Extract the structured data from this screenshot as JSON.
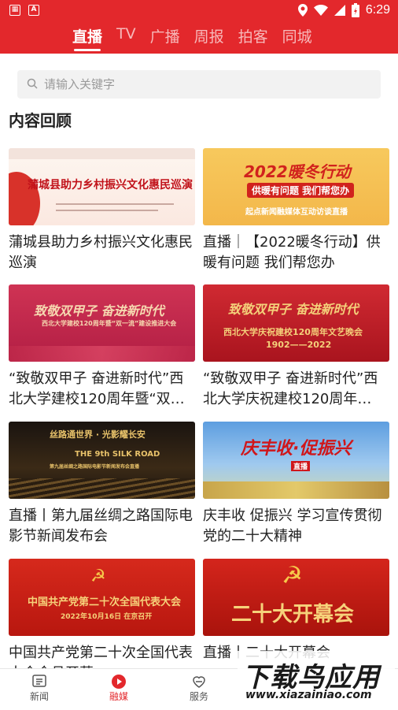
{
  "status": {
    "time": "6:29"
  },
  "tabs": [
    "直播",
    "TV",
    "广播",
    "周报",
    "拍客",
    "同城"
  ],
  "search": {
    "placeholder": "请输入关键字"
  },
  "section_title": "内容回顾",
  "cards": [
    {
      "caption": "蒲城县助力乡村振兴文化惠民巡演",
      "thumb_text": "蒲城县助力乡村振兴文化惠民巡演",
      "thumb_top": "",
      "thumb_bottom": ""
    },
    {
      "caption": "直播｜【2022暖冬行动】供暖有问题 我们帮您办",
      "thumb_text": "2022暖冬行动",
      "thumb_top": "供暖有问题  我们帮您办",
      "thumb_bottom": "起点新闻融媒体互动访谈直播"
    },
    {
      "caption": "“致敬双甲子 奋进新时代”西北大学建校120周年暨“双…",
      "thumb_text": "致敬双甲子  奋进新时代",
      "thumb_top": "西北大学建校120周年暨“双一流”建设推进大会",
      "thumb_bottom": ""
    },
    {
      "caption": "“致敬双甲子 奋进新时代”西北大学庆祝建校120周年…",
      "thumb_text": "致敬双甲子 奋进新时代",
      "thumb_top": "西北大学庆祝建校120周年文艺晚会",
      "thumb_bottom": "1902——2022"
    },
    {
      "caption": "直播丨第九届丝绸之路国际电影节新闻发布会",
      "thumb_text": "丝路通世界 · 光影耀长安",
      "thumb_top": "THE 9th SILK ROAD",
      "thumb_bottom": "第九届丝绸之路国际电影节新闻发布会直播"
    },
    {
      "caption": "庆丰收 促振兴 学习宣传贯彻党的二十大精神",
      "thumb_text": "庆丰收·促振兴",
      "thumb_top": "直播",
      "thumb_bottom": ""
    },
    {
      "caption": "中国共产党第二十次全国代表大会会旦开幕",
      "thumb_text": "中国共产党第二十次全国代表大会",
      "thumb_top": "2022年10月16日 在京召开",
      "thumb_bottom": ""
    },
    {
      "caption": "直播丨二十大开幕会",
      "thumb_text": "二十大开幕会",
      "thumb_top": "",
      "thumb_bottom": ""
    }
  ],
  "bottom_nav": [
    {
      "label": "新闻",
      "icon": "news-icon"
    },
    {
      "label": "融媒",
      "icon": "play-icon"
    },
    {
      "label": "服务",
      "icon": "service-icon"
    }
  ],
  "watermark": {
    "big": "下载鸟应用",
    "small": "www.xiazainiao.com"
  },
  "colors": {
    "brand": "#e3282c"
  }
}
